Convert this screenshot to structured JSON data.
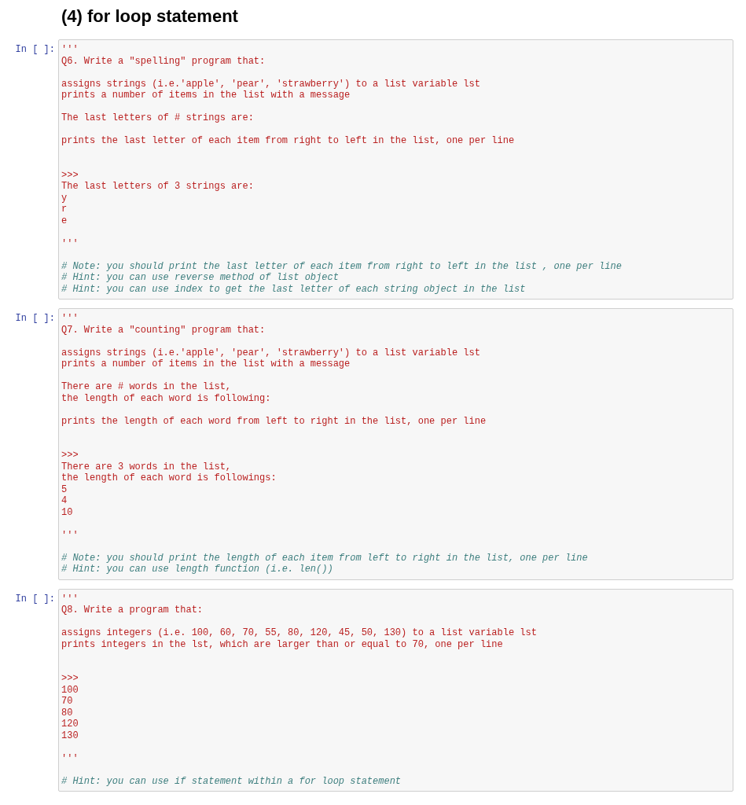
{
  "heading": "(4) for loop statement",
  "cells": [
    {
      "prompt": "In [ ]:",
      "lines": [
        {
          "kind": "string",
          "text": "'''"
        },
        {
          "kind": "string",
          "text": "Q6. Write a \"spelling\" program that:"
        },
        {
          "kind": "blank"
        },
        {
          "kind": "string",
          "text": "assigns strings (i.e.'apple', 'pear', 'strawberry') to a list variable lst"
        },
        {
          "kind": "string",
          "text": "prints a number of items in the list with a message"
        },
        {
          "kind": "blank"
        },
        {
          "kind": "string",
          "text": "The last letters of # strings are:"
        },
        {
          "kind": "blank"
        },
        {
          "kind": "string",
          "text": "prints the last letter of each item from right to left in the list, one per line"
        },
        {
          "kind": "blank"
        },
        {
          "kind": "blank"
        },
        {
          "kind": "string",
          "text": ">>>"
        },
        {
          "kind": "string",
          "text": "The last letters of 3 strings are:"
        },
        {
          "kind": "string",
          "text": "y"
        },
        {
          "kind": "string",
          "text": "r"
        },
        {
          "kind": "string",
          "text": "e"
        },
        {
          "kind": "blank"
        },
        {
          "kind": "string",
          "text": "'''"
        },
        {
          "kind": "blank"
        },
        {
          "kind": "comment",
          "text": "# Note: you should print the last letter of each item from right to left in the list , one per line"
        },
        {
          "kind": "comment",
          "text": "# Hint: you can use reverse method of list object"
        },
        {
          "kind": "comment",
          "text": "# Hint: you can use index to get the last letter of each string object in the list"
        }
      ]
    },
    {
      "prompt": "In [ ]:",
      "lines": [
        {
          "kind": "string",
          "text": "'''"
        },
        {
          "kind": "string",
          "text": "Q7. Write a \"counting\" program that:"
        },
        {
          "kind": "blank"
        },
        {
          "kind": "string",
          "text": "assigns strings (i.e.'apple', 'pear', 'strawberry') to a list variable lst"
        },
        {
          "kind": "string",
          "text": "prints a number of items in the list with a message"
        },
        {
          "kind": "blank"
        },
        {
          "kind": "string",
          "text": "There are # words in the list,"
        },
        {
          "kind": "string",
          "text": "the length of each word is following:"
        },
        {
          "kind": "blank"
        },
        {
          "kind": "string",
          "text": "prints the length of each word from left to right in the list, one per line"
        },
        {
          "kind": "blank"
        },
        {
          "kind": "blank"
        },
        {
          "kind": "string",
          "text": ">>>"
        },
        {
          "kind": "string",
          "text": "There are 3 words in the list,"
        },
        {
          "kind": "string",
          "text": "the length of each word is followings:"
        },
        {
          "kind": "string",
          "text": "5"
        },
        {
          "kind": "string",
          "text": "4"
        },
        {
          "kind": "string",
          "text": "10"
        },
        {
          "kind": "blank"
        },
        {
          "kind": "string",
          "text": "'''"
        },
        {
          "kind": "blank"
        },
        {
          "kind": "comment",
          "text": "# Note: you should print the length of each item from left to right in the list, one per line"
        },
        {
          "kind": "comment",
          "text": "# Hint: you can use length function (i.e. len())"
        }
      ]
    },
    {
      "prompt": "In [ ]:",
      "lines": [
        {
          "kind": "string",
          "text": "'''"
        },
        {
          "kind": "string",
          "text": "Q8. Write a program that:"
        },
        {
          "kind": "blank"
        },
        {
          "kind": "string",
          "text": "assigns integers (i.e. 100, 60, 70, 55, 80, 120, 45, 50, 130) to a list variable lst"
        },
        {
          "kind": "string",
          "text": "prints integers in the lst, which are larger than or equal to 70, one per line"
        },
        {
          "kind": "blank"
        },
        {
          "kind": "blank"
        },
        {
          "kind": "string",
          "text": ">>>"
        },
        {
          "kind": "string",
          "text": "100"
        },
        {
          "kind": "string",
          "text": "70"
        },
        {
          "kind": "string",
          "text": "80"
        },
        {
          "kind": "string",
          "text": "120"
        },
        {
          "kind": "string",
          "text": "130"
        },
        {
          "kind": "blank"
        },
        {
          "kind": "string",
          "text": "'''"
        },
        {
          "kind": "blank"
        },
        {
          "kind": "comment",
          "text": "# Hint: you can use if statement within a for loop statement"
        }
      ]
    }
  ]
}
